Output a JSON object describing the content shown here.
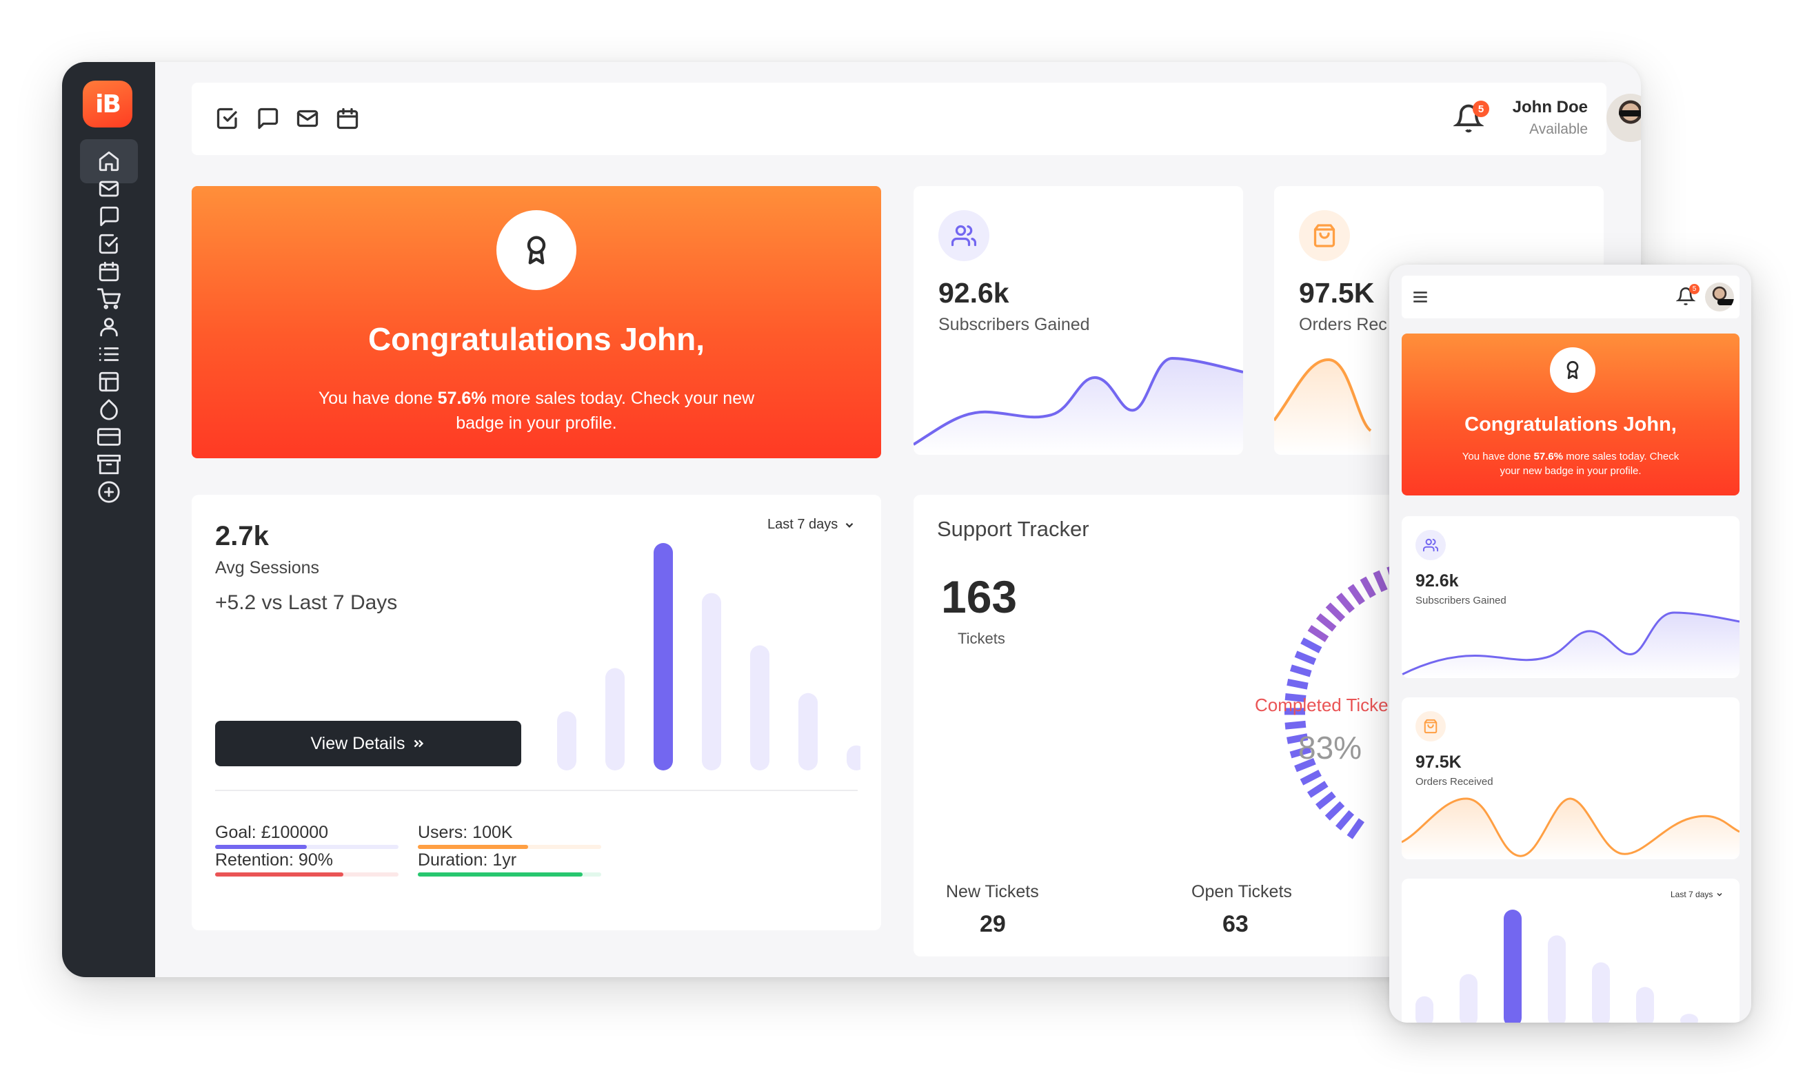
{
  "app": {
    "logo_text": "iB"
  },
  "sidebar": {
    "items": [
      {
        "icon": "home-icon",
        "active": true
      },
      {
        "icon": "mail-icon"
      },
      {
        "icon": "chat-icon"
      },
      {
        "icon": "checkbox-icon"
      },
      {
        "icon": "calendar-icon"
      },
      {
        "icon": "cart-icon"
      },
      {
        "icon": "user-icon"
      },
      {
        "icon": "list-icon"
      },
      {
        "icon": "layout-icon"
      },
      {
        "icon": "droplet-icon"
      },
      {
        "icon": "credit-card-icon"
      },
      {
        "icon": "archive-icon"
      },
      {
        "icon": "plus-circle-icon"
      }
    ]
  },
  "topbar": {
    "icons": [
      "checkbox-icon",
      "chat-icon",
      "mail-icon",
      "calendar-icon"
    ],
    "notifications": "5",
    "user_name": "John Doe",
    "user_status": "Available"
  },
  "congrats": {
    "title": "Congratulations John,",
    "text_before": "You have done ",
    "highlight": "57.6%",
    "text_after": " more sales today. Check your new badge in your profile.",
    "mobile_text_after": " more sales today. Check your new badge in your profile."
  },
  "subscribers": {
    "value": "92.6k",
    "label": "Subscribers Gained",
    "color": "#7367f0"
  },
  "orders": {
    "value": "97.5K",
    "label": "Orders Received",
    "label_clipped": "Orders Rec",
    "color": "#ff9f43"
  },
  "sessions": {
    "value": "2.7k",
    "label": "Avg Sessions",
    "change": "+5.2 vs Last 7 Days",
    "range": "Last 7 days",
    "button": "View Details",
    "button_icon": "chevrons-right-icon",
    "bars": [
      26,
      45,
      100,
      78,
      55,
      34,
      11
    ],
    "highlight_index": 2,
    "progress": [
      {
        "label": "Goal: £100000",
        "value": 0.5,
        "color": "#7367f0"
      },
      {
        "label": "Users: 100K",
        "value": 0.6,
        "color": "#ff9f43"
      },
      {
        "label": "Retention: 90%",
        "value": 0.7,
        "color": "#ea5455"
      },
      {
        "label": "Duration: 1yr",
        "value": 0.9,
        "color": "#28c76f"
      }
    ]
  },
  "support": {
    "title": "Support Tracker",
    "tickets_value": "163",
    "tickets_label": "Tickets",
    "completed_label": "Completed Tickets",
    "completed_label_clipped": "Completed Ticke",
    "completed_value": "83%",
    "completed_fraction": 0.83,
    "new_label": "New Tickets",
    "new_value": "29",
    "open_label": "Open Tickets",
    "open_value": "63"
  },
  "mobile": {
    "menu_icon": "hamburger-icon",
    "notifications": "5",
    "range": "Last 7 days"
  }
}
